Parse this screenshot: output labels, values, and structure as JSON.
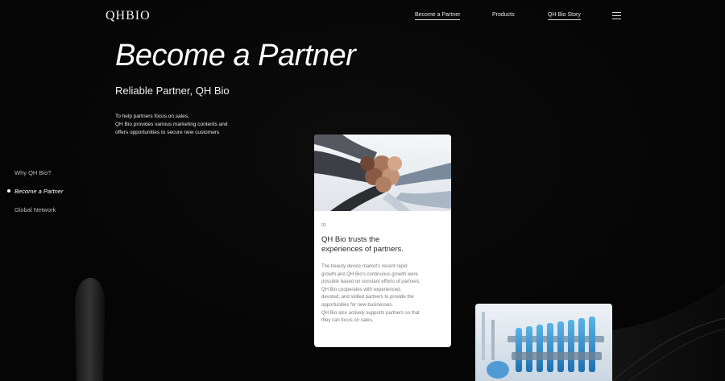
{
  "header": {
    "logo": "QHBIO",
    "nav": [
      {
        "label": "Become a Partner",
        "active": true
      },
      {
        "label": "Products",
        "active": false
      },
      {
        "label": "QH Bio Story",
        "active": false
      }
    ],
    "menu_icon": "hamburger-menu-icon"
  },
  "hero": {
    "title": "Become a Partner",
    "subtitle": "Reliable Partner, QH Bio",
    "description": [
      "To help partners focus on sales,",
      "QH Bio provides various marketing contents and",
      "offers opportunities to secure new customers"
    ]
  },
  "side_nav": {
    "items": [
      {
        "label": "Why QH Bio?",
        "active": false
      },
      {
        "label": "Become a Partner",
        "active": true
      },
      {
        "label": "Global Network",
        "active": false
      }
    ]
  },
  "cards": [
    {
      "number": "01",
      "image": "team-fist-bump-photo",
      "title_lines": [
        "QH Bio trusts the",
        "experiences of partners."
      ],
      "body_lines": [
        "The beauty device market's recent rapid",
        "growth and QH Bio's continuous growth were",
        "possible based on constant efforts of partners.",
        "QH Bio cooperates with experienced,",
        "devoted, and skilled partners to provide the",
        "opportunities for new businesses.",
        "QH Bio also actively supports partners so that",
        "they can focus on sales."
      ]
    },
    {
      "image": "laboratory-test-tubes-photo"
    }
  ],
  "colors": {
    "background": "#050505",
    "card_background": "#ffffff",
    "accent_number": "#4f7f7a"
  }
}
